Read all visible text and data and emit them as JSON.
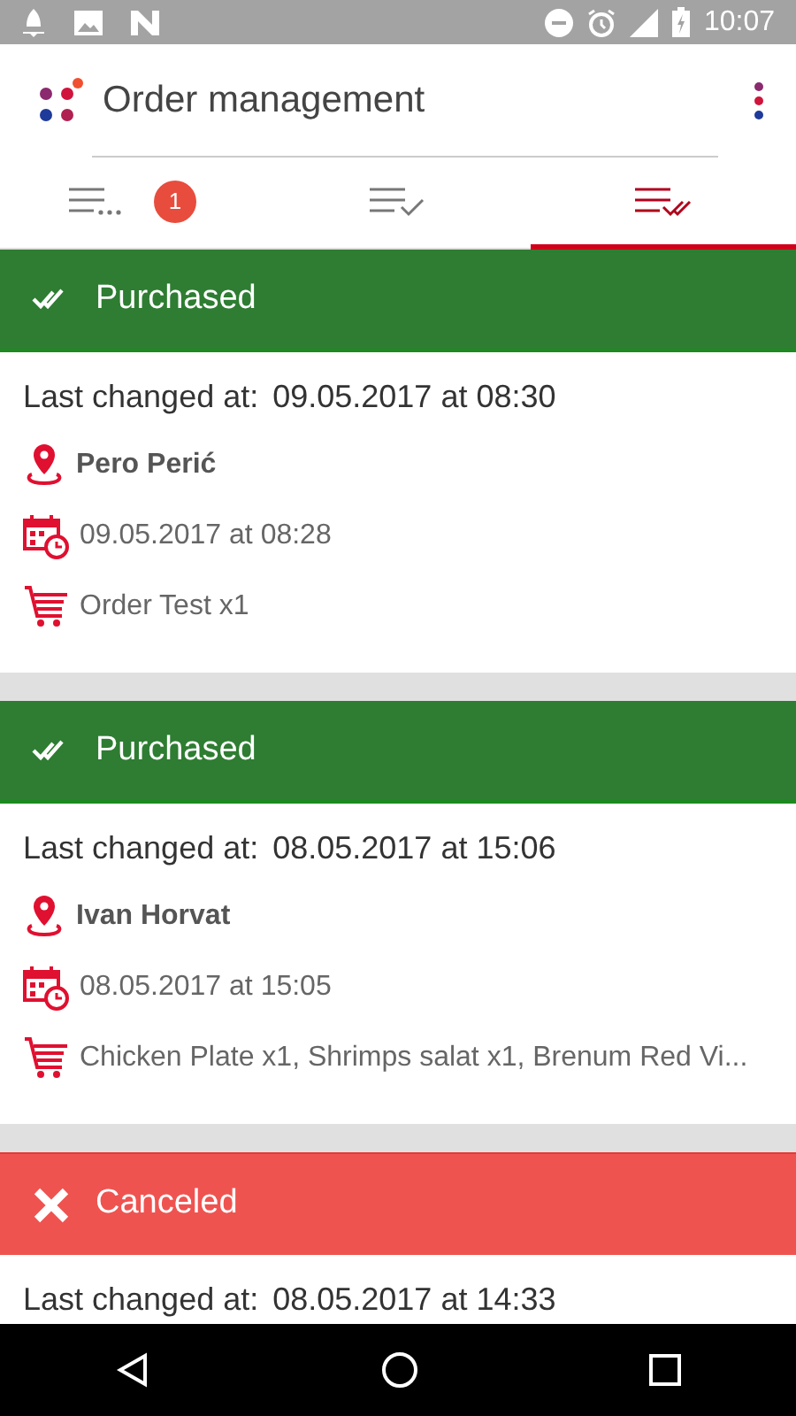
{
  "status_bar": {
    "time": "10:07"
  },
  "app_bar": {
    "title": "Order management"
  },
  "tabs": [
    {
      "kind": "pending",
      "badge": "1",
      "selected": false
    },
    {
      "kind": "confirmed",
      "selected": false
    },
    {
      "kind": "done",
      "selected": true
    }
  ],
  "orders": [
    {
      "kind": "purchased",
      "status": "Purchased",
      "last_changed_label": "Last changed at:",
      "last_changed": "09.05.2017 at 08:30",
      "customer": "Pero Perić",
      "date": "09.05.2017 at 08:28",
      "items": "Order Test x1"
    },
    {
      "kind": "purchased",
      "status": "Purchased",
      "last_changed_label": "Last changed at:",
      "last_changed": "08.05.2017 at 15:06",
      "customer": "Ivan Horvat",
      "date": "08.05.2017 at 15:05",
      "items": "Chicken Plate x1, Shrimps salat x1, Brenum Red Vi..."
    },
    {
      "kind": "canceled",
      "status": "Canceled",
      "last_changed_label": "Last changed at:",
      "last_changed": "08.05.2017 at 14:33"
    }
  ]
}
